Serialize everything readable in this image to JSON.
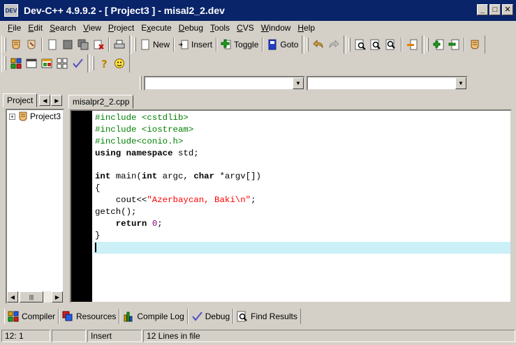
{
  "window": {
    "title": "Dev-C++ 4.9.9.2  - [ Project3 ] - misal2_2.dev",
    "app_icon_text": "DEV"
  },
  "menubar": [
    {
      "label": "File",
      "key": "F"
    },
    {
      "label": "Edit",
      "key": "E"
    },
    {
      "label": "Search",
      "key": "S"
    },
    {
      "label": "View",
      "key": "V"
    },
    {
      "label": "Project",
      "key": "P"
    },
    {
      "label": "Execute",
      "key": "x"
    },
    {
      "label": "Debug",
      "key": "D"
    },
    {
      "label": "Tools",
      "key": "T"
    },
    {
      "label": "CVS",
      "key": "C"
    },
    {
      "label": "Window",
      "key": "W"
    },
    {
      "label": "Help",
      "key": "H"
    }
  ],
  "toolbar": {
    "new_label": "New",
    "insert_label": "Insert",
    "toggle_label": "Toggle",
    "goto_label": "Goto"
  },
  "combos": {
    "class_value": "",
    "member_value": ""
  },
  "left_panel": {
    "tab_label": "Project",
    "tree_root": "Project3"
  },
  "editor": {
    "tab_label": "misalpr2_2.cpp",
    "lines": [
      "#include <cstdlib>",
      "#include <iostream>",
      "#include<conio.h>",
      "using namespace std;",
      "",
      "int main(int argc, char *argv[])",
      "{",
      "    cout<<\"Azerbaycan, Baki\\n\";",
      "getch();",
      "    return 0;",
      "}",
      ""
    ],
    "current_line": 12
  },
  "bottom_tabs": [
    "Compiler",
    "Resources",
    "Compile Log",
    "Debug",
    "Find Results"
  ],
  "status": {
    "position": "12: 1",
    "modified": "",
    "mode": "Insert",
    "info": "12 Lines in file"
  },
  "colors": {
    "titlebar": "#0a246a",
    "current_line": "#ccf0f8",
    "preprocessor": "#008000",
    "string": "#ff0000",
    "number": "#800080"
  }
}
